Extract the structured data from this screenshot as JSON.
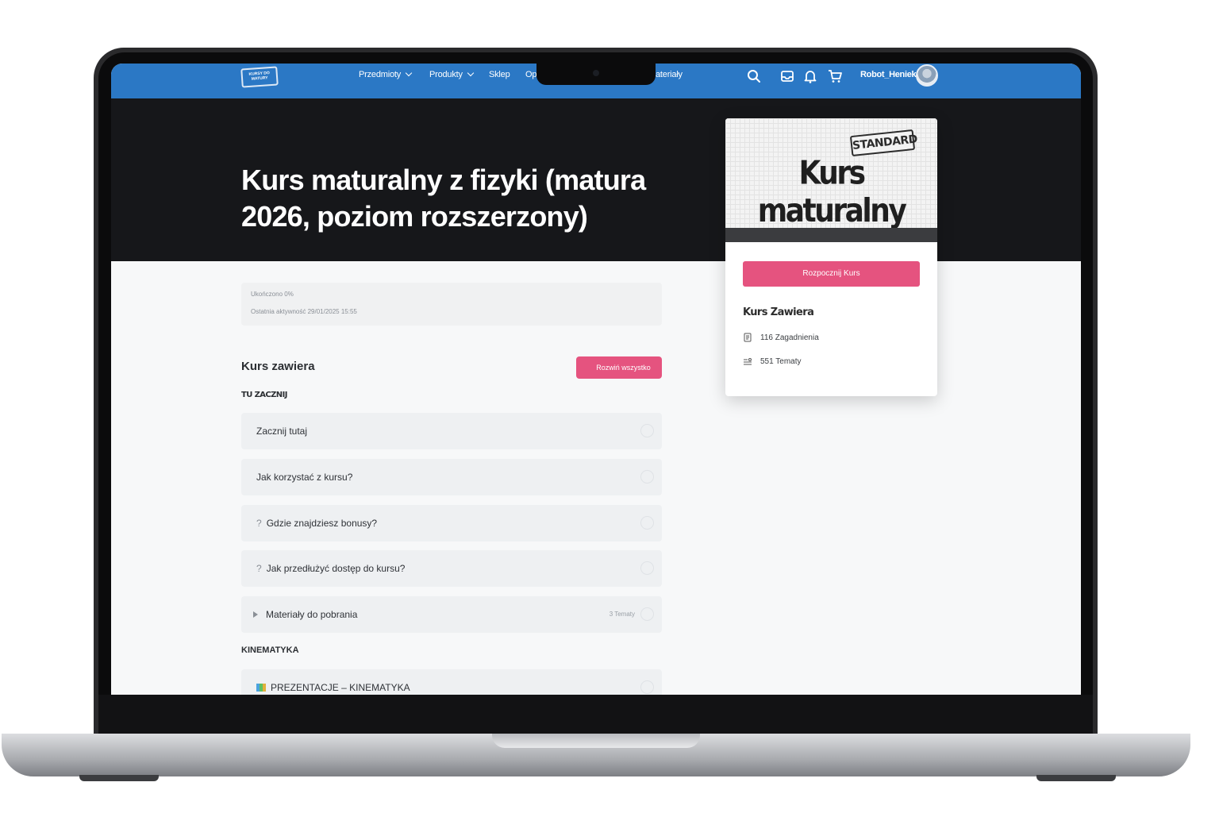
{
  "nav": {
    "logo_text": "KURSY DO MATURY",
    "items": [
      {
        "label": "Przedmioty",
        "has_dropdown": true
      },
      {
        "label": "Produkty",
        "has_dropdown": true
      },
      {
        "label": "Sklep",
        "has_dropdown": false
      },
      {
        "label": "Op",
        "has_dropdown": false
      },
      {
        "label": "ateriały",
        "has_dropdown": false
      }
    ],
    "icons": [
      "search-icon",
      "inbox-icon",
      "bell-icon",
      "cart-icon"
    ],
    "username": "Robot_Heniek",
    "color": "#2b78c5"
  },
  "hero": {
    "title": "Kurs maturalny z fizyki (matura 2026, poziom rozszerzony)"
  },
  "progress": {
    "completed_label": "Ukończono 0%",
    "completed_percent": 0,
    "last_activity": "Ostatnia aktywność 29/01/2025 15:55"
  },
  "content": {
    "heading": "Kurs zawiera",
    "expand_all": "Rozwiń wszystko",
    "groups": [
      {
        "label": "TU ZACZNIJ",
        "lessons": [
          {
            "label": "Zacznij tutaj",
            "prefix": ""
          },
          {
            "label": "Jak korzystać z kursu?",
            "prefix": ""
          },
          {
            "label": "Gdzie znajdziesz bonusy?",
            "prefix": "?"
          },
          {
            "label": "Jak przedłużyć dostęp do kursu?",
            "prefix": "?"
          },
          {
            "label": "Materiały do pobrania",
            "prefix": "▸",
            "meta": "3 Tematy"
          }
        ]
      },
      {
        "label": "KINEMATYKA",
        "lessons": [
          {
            "label": "PREZENTACJE – KINEMATYKA",
            "prefix": "books"
          }
        ]
      }
    ]
  },
  "card": {
    "stamp": "STANDARD",
    "cover_title": "Kurs maturalny",
    "start_button": "Rozpocznij Kurs",
    "includes_heading": "Kurs Zawiera",
    "stats": [
      {
        "icon": "document-icon",
        "label": "116 Zagadnienia"
      },
      {
        "icon": "list-icon",
        "label": "551 Tematy"
      }
    ],
    "accent": "#e5537f"
  }
}
